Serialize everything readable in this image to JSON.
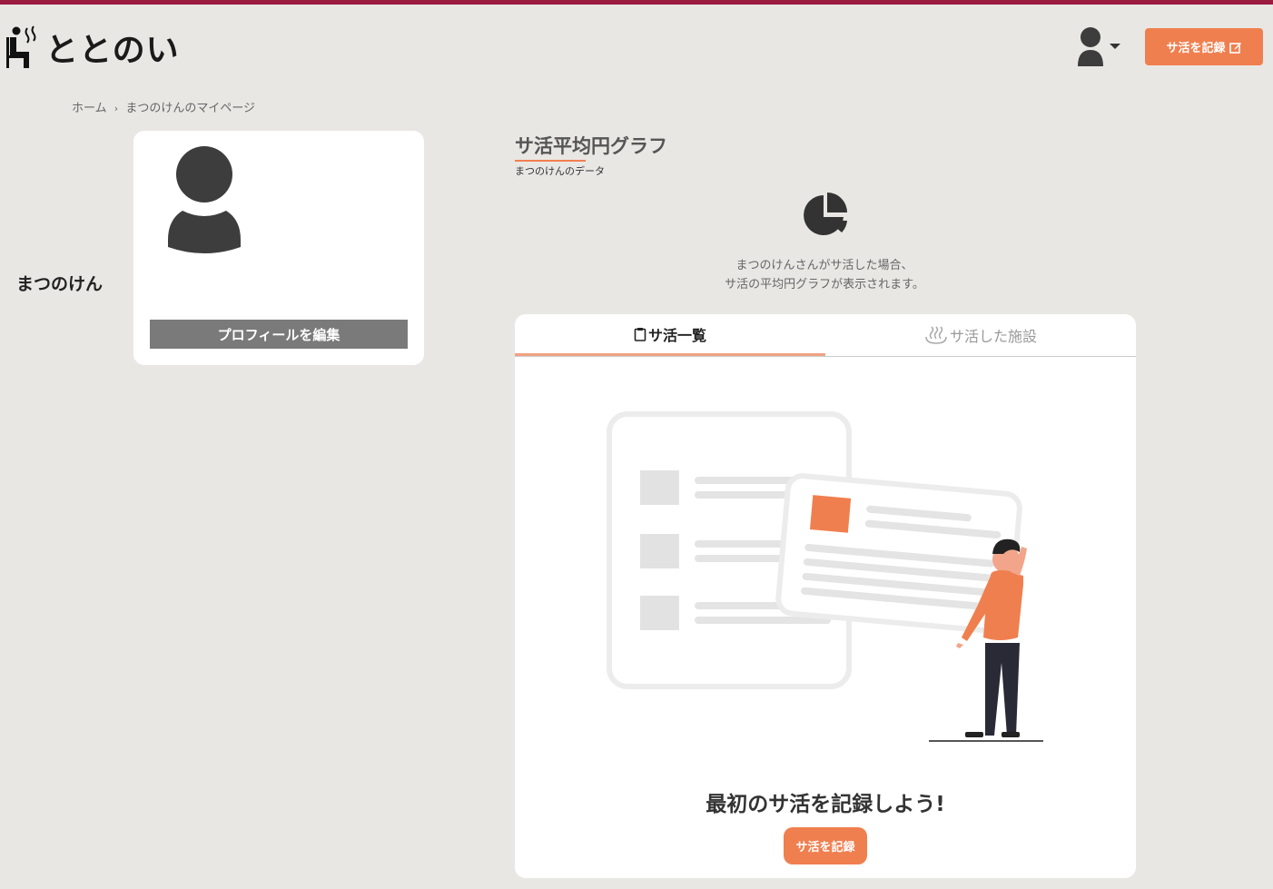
{
  "header": {
    "logo_text": "ととのい",
    "record_button_label": "サ活を記録"
  },
  "breadcrumb": {
    "home": "ホーム",
    "separator": "›",
    "current": "まつのけんのマイページ"
  },
  "profile": {
    "name": "まつのけん",
    "edit_button_label": "プロフィールを編集"
  },
  "graph": {
    "title": "サ活平均円グラフ",
    "subtitle": "まつのけんのデータ",
    "message_line1": "まつのけんさんがサ活した場合、",
    "message_line2": "サ活の平均円グラフが表示されます。"
  },
  "tabs": [
    {
      "label": "サ活一覧",
      "active": true,
      "icon": "clipboard-icon"
    },
    {
      "label": "サ活した施設",
      "active": false,
      "icon": "hot-spring-icon"
    }
  ],
  "empty_state": {
    "title": "最初のサ活を記録しよう!",
    "button_label": "サ活を記録"
  },
  "colors": {
    "accent": "#f07f4f",
    "top_bar": "#9b1b3f",
    "background": "#e9e7e4",
    "edit_button": "#7a7a7a"
  }
}
